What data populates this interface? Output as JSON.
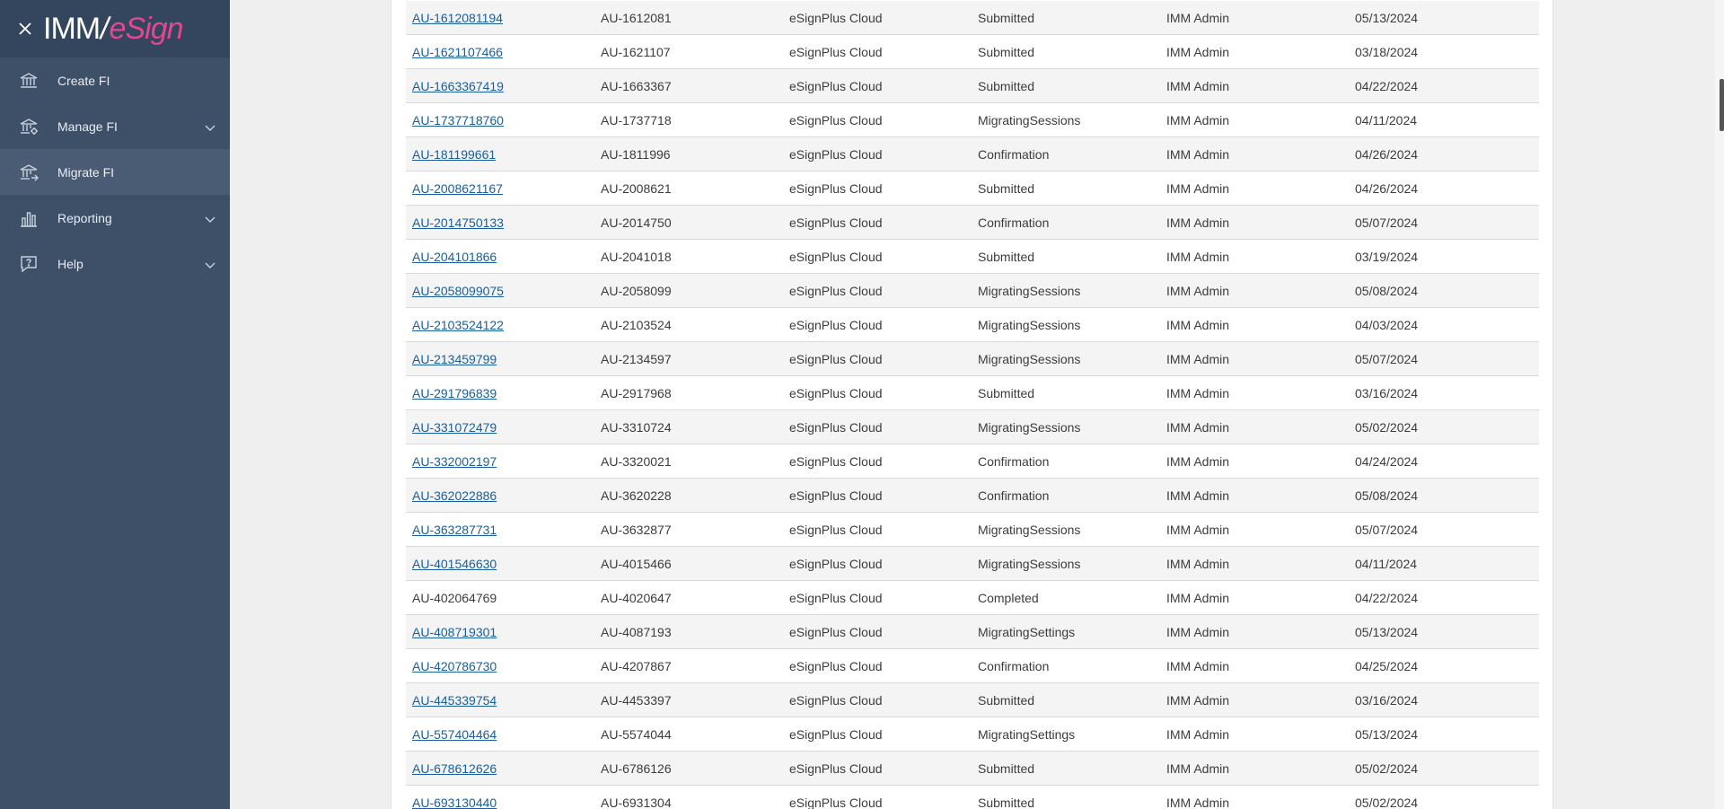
{
  "logo": {
    "part1": "IMM",
    "part2": "/",
    "part3": "eSign"
  },
  "sidebar": {
    "items": [
      {
        "label": "Create FI",
        "icon": "bank-icon",
        "expandable": false,
        "active": false
      },
      {
        "label": "Manage FI",
        "icon": "bank-gear-icon",
        "expandable": true,
        "active": false
      },
      {
        "label": "Migrate FI",
        "icon": "bank-migrate-icon",
        "expandable": false,
        "active": true
      },
      {
        "label": "Reporting",
        "icon": "bar-chart-icon",
        "expandable": true,
        "active": false
      },
      {
        "label": "Help",
        "icon": "help-chat-icon",
        "expandable": true,
        "active": false
      }
    ]
  },
  "table": {
    "rows": [
      {
        "id": "AU-1612081194",
        "link": true,
        "fi": "AU-1612081",
        "product": "eSignPlus Cloud",
        "status": "Submitted",
        "user": "IMM Admin",
        "date": "05/13/2024"
      },
      {
        "id": "AU-1621107466",
        "link": true,
        "fi": "AU-1621107",
        "product": "eSignPlus Cloud",
        "status": "Submitted",
        "user": "IMM Admin",
        "date": "03/18/2024"
      },
      {
        "id": "AU-1663367419",
        "link": true,
        "fi": "AU-1663367",
        "product": "eSignPlus Cloud",
        "status": "Submitted",
        "user": "IMM Admin",
        "date": "04/22/2024"
      },
      {
        "id": "AU-1737718760",
        "link": true,
        "fi": "AU-1737718",
        "product": "eSignPlus Cloud",
        "status": "MigratingSessions",
        "user": "IMM Admin",
        "date": "04/11/2024"
      },
      {
        "id": "AU-181199661",
        "link": true,
        "fi": "AU-1811996",
        "product": "eSignPlus Cloud",
        "status": "Confirmation",
        "user": "IMM Admin",
        "date": "04/26/2024"
      },
      {
        "id": "AU-2008621167",
        "link": true,
        "fi": "AU-2008621",
        "product": "eSignPlus Cloud",
        "status": "Submitted",
        "user": "IMM Admin",
        "date": "04/26/2024"
      },
      {
        "id": "AU-2014750133",
        "link": true,
        "fi": "AU-2014750",
        "product": "eSignPlus Cloud",
        "status": "Confirmation",
        "user": "IMM Admin",
        "date": "05/07/2024"
      },
      {
        "id": "AU-204101866",
        "link": true,
        "fi": "AU-2041018",
        "product": "eSignPlus Cloud",
        "status": "Submitted",
        "user": "IMM Admin",
        "date": "03/19/2024"
      },
      {
        "id": "AU-2058099075",
        "link": true,
        "fi": "AU-2058099",
        "product": "eSignPlus Cloud",
        "status": "MigratingSessions",
        "user": "IMM Admin",
        "date": "05/08/2024"
      },
      {
        "id": "AU-2103524122",
        "link": true,
        "fi": "AU-2103524",
        "product": "eSignPlus Cloud",
        "status": "MigratingSessions",
        "user": "IMM Admin",
        "date": "04/03/2024"
      },
      {
        "id": "AU-213459799",
        "link": true,
        "fi": "AU-2134597",
        "product": "eSignPlus Cloud",
        "status": "MigratingSessions",
        "user": "IMM Admin",
        "date": "05/07/2024"
      },
      {
        "id": "AU-291796839",
        "link": true,
        "fi": "AU-2917968",
        "product": "eSignPlus Cloud",
        "status": "Submitted",
        "user": "IMM Admin",
        "date": "03/16/2024"
      },
      {
        "id": "AU-331072479",
        "link": true,
        "fi": "AU-3310724",
        "product": "eSignPlus Cloud",
        "status": "MigratingSessions",
        "user": "IMM Admin",
        "date": "05/02/2024"
      },
      {
        "id": "AU-332002197",
        "link": true,
        "fi": "AU-3320021",
        "product": "eSignPlus Cloud",
        "status": "Confirmation",
        "user": "IMM Admin",
        "date": "04/24/2024"
      },
      {
        "id": "AU-362022886",
        "link": true,
        "fi": "AU-3620228",
        "product": "eSignPlus Cloud",
        "status": "Confirmation",
        "user": "IMM Admin",
        "date": "05/08/2024"
      },
      {
        "id": "AU-363287731",
        "link": true,
        "fi": "AU-3632877",
        "product": "eSignPlus Cloud",
        "status": "MigratingSessions",
        "user": "IMM Admin",
        "date": "05/07/2024"
      },
      {
        "id": "AU-401546630",
        "link": true,
        "fi": "AU-4015466",
        "product": "eSignPlus Cloud",
        "status": "MigratingSessions",
        "user": "IMM Admin",
        "date": "04/11/2024"
      },
      {
        "id": "AU-402064769",
        "link": false,
        "fi": "AU-4020647",
        "product": "eSignPlus Cloud",
        "status": "Completed",
        "user": "IMM Admin",
        "date": "04/22/2024"
      },
      {
        "id": "AU-408719301",
        "link": true,
        "fi": "AU-4087193",
        "product": "eSignPlus Cloud",
        "status": "MigratingSettings",
        "user": "IMM Admin",
        "date": "05/13/2024"
      },
      {
        "id": "AU-420786730",
        "link": true,
        "fi": "AU-4207867",
        "product": "eSignPlus Cloud",
        "status": "Confirmation",
        "user": "IMM Admin",
        "date": "04/25/2024"
      },
      {
        "id": "AU-445339754",
        "link": true,
        "fi": "AU-4453397",
        "product": "eSignPlus Cloud",
        "status": "Submitted",
        "user": "IMM Admin",
        "date": "03/16/2024"
      },
      {
        "id": "AU-557404464",
        "link": true,
        "fi": "AU-5574044",
        "product": "eSignPlus Cloud",
        "status": "MigratingSettings",
        "user": "IMM Admin",
        "date": "05/13/2024"
      },
      {
        "id": "AU-678612626",
        "link": true,
        "fi": "AU-6786126",
        "product": "eSignPlus Cloud",
        "status": "Submitted",
        "user": "IMM Admin",
        "date": "05/02/2024"
      },
      {
        "id": "AU-693130440",
        "link": true,
        "fi": "AU-6931304",
        "product": "eSignPlus Cloud",
        "status": "Submitted",
        "user": "IMM Admin",
        "date": "05/02/2024"
      }
    ]
  }
}
